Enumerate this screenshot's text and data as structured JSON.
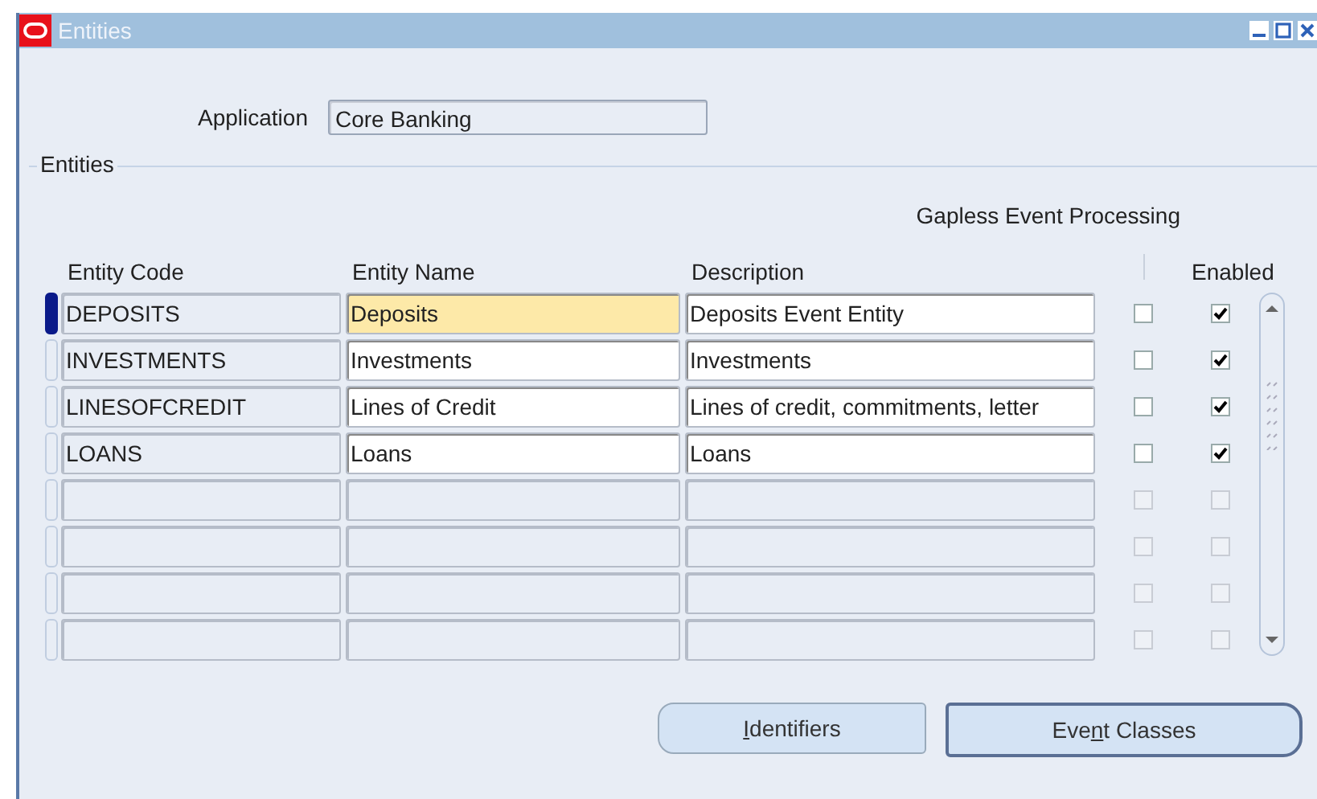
{
  "window": {
    "title": "Entities"
  },
  "application": {
    "label": "Application",
    "value": "Core Banking"
  },
  "entities": {
    "title": "Entities",
    "group_header": "Gapless Event Processing",
    "columns": [
      "Entity Code",
      "Entity Name",
      "Description",
      "Enabled"
    ],
    "rows": [
      {
        "code": "DEPOSITS",
        "name": "Deposits",
        "description": "Deposits Event Entity",
        "gapless": false,
        "enabled": true,
        "selected": true,
        "disabled": false
      },
      {
        "code": "INVESTMENTS",
        "name": "Investments",
        "description": "Investments",
        "gapless": false,
        "enabled": true,
        "selected": false,
        "disabled": false
      },
      {
        "code": "LINESOFCREDIT",
        "name": "Lines of Credit",
        "description": "Lines of credit, commitments, letter",
        "gapless": false,
        "enabled": true,
        "selected": false,
        "disabled": false
      },
      {
        "code": "LOANS",
        "name": "Loans",
        "description": "Loans",
        "gapless": false,
        "enabled": true,
        "selected": false,
        "disabled": false
      },
      {
        "gapless": false,
        "enabled": false,
        "selected": false,
        "disabled": true
      },
      {
        "gapless": false,
        "enabled": false,
        "selected": false,
        "disabled": true
      },
      {
        "gapless": false,
        "enabled": false,
        "selected": false,
        "disabled": true
      },
      {
        "gapless": false,
        "enabled": false,
        "selected": false,
        "disabled": true
      }
    ]
  },
  "buttons": [
    {
      "mnemonic": "I",
      "after": "dentifiers",
      "default": false
    },
    {
      "before": "Eve",
      "mnemonic": "n",
      "after": "t Classes",
      "default": true
    }
  ]
}
